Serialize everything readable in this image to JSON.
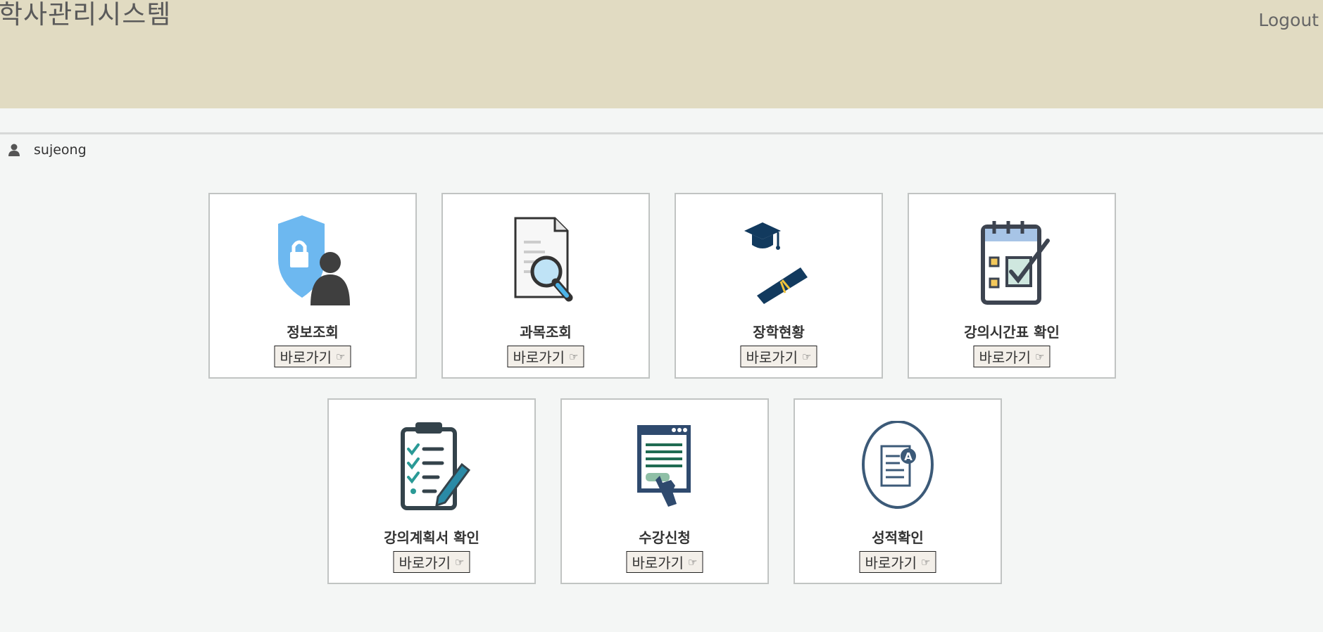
{
  "header": {
    "title": "학사관리시스템",
    "logout": "Logout"
  },
  "user": {
    "name": "sujeong"
  },
  "cards": [
    {
      "label": "정보조회",
      "button": "바로가기",
      "icon": "shield-person-icon"
    },
    {
      "label": "과목조회",
      "button": "바로가기",
      "icon": "document-search-icon"
    },
    {
      "label": "장학현황",
      "button": "바로가기",
      "icon": "graduation-diploma-icon"
    },
    {
      "label": "강의시간표 확인",
      "button": "바로가기",
      "icon": "calendar-check-icon"
    },
    {
      "label": "강의계획서 확인",
      "button": "바로가기",
      "icon": "clipboard-checklist-icon"
    },
    {
      "label": "수강신청",
      "button": "바로가기",
      "icon": "web-form-click-icon"
    },
    {
      "label": "성적확인",
      "button": "바로가기",
      "icon": "report-grade-icon"
    }
  ],
  "colors": {
    "header_bg": "#e1dbc2",
    "page_bg": "#f4f6f5",
    "card_border": "#c1c4c3",
    "button_bg": "#f3efe9"
  }
}
